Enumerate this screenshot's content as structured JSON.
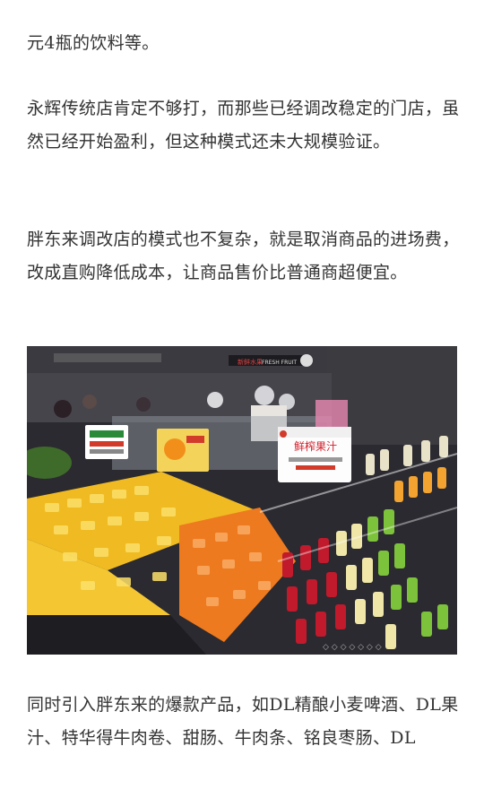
{
  "article": {
    "paragraphs": [
      "元4瓶的饮料等。",
      "永辉传统店肯定不够打，而那些已经调改稳定的门店，虽然已经开始盈利，但这种模式还未大规模验证。",
      "胖东来调改店的模式也不复杂，就是取消商品的进场费，改成直购降低成本，让商品售价比普通商超便宜。",
      "同时引入胖东来的爆款产品，如DL精酿小麦啤酒、DL果汁、特华得牛肉卷、甜肠、牛肉条、铭良枣肠、DL"
    ]
  },
  "photo": {
    "description_icon": "supermarket-fresh-fruit-juice-display-image",
    "signs": {
      "juice_sign": "鲜榨果汁",
      "store_banner": "FRESH FRUIT"
    },
    "colors": {
      "background": "#2a2a30",
      "mango": "#f5c21b",
      "orange": "#f07a1e",
      "red_juice": "#c0182a",
      "green_juice": "#7cc23a",
      "pale_juice": "#efe6a8"
    }
  }
}
